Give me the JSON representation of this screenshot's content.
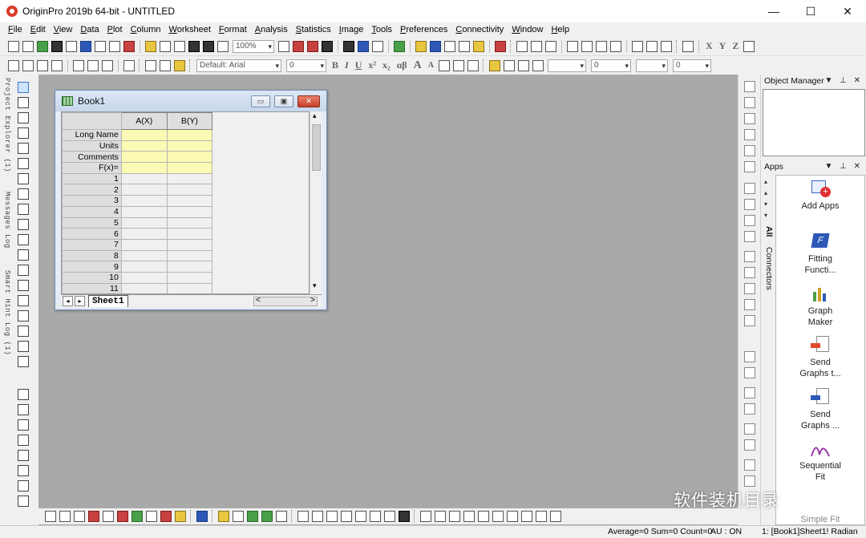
{
  "window": {
    "title": "OriginPro 2019b 64-bit - UNTITLED",
    "min_glyph": "—",
    "max_glyph": "☐",
    "close_glyph": "✕"
  },
  "menu": [
    "File",
    "Edit",
    "View",
    "Data",
    "Plot",
    "Column",
    "Worksheet",
    "Format",
    "Analysis",
    "Statistics",
    "Image",
    "Tools",
    "Preferences",
    "Connectivity",
    "Window",
    "Help"
  ],
  "toolbar": {
    "zoom_value": "100%",
    "font_value": "Default: Arial",
    "font_size_value": "0",
    "bold_label": "B",
    "italic_label": "I",
    "underline_label": "U",
    "superscript_label": "x²",
    "subscript_label": "x₂",
    "greek_label": "αβ",
    "grow_label": "A",
    "shrink_label": "A",
    "line_width_value": "0",
    "line_extra_value": "0",
    "fx_labels": [
      "X",
      "Y",
      "Z"
    ]
  },
  "left_tabs": {
    "project_explorer": "Project Explorer (1)",
    "messages_log": "Messages Log",
    "smart_hint_log": "Smart Hint Log (1)"
  },
  "book": {
    "name": "Book1",
    "min_glyph": "▭",
    "restore_glyph": "▣",
    "close_glyph": "✕",
    "columns": [
      "A(X)",
      "B(Y)"
    ],
    "meta_rows": [
      "Long Name",
      "Units",
      "Comments",
      "F(x)="
    ],
    "rows": [
      "1",
      "2",
      "3",
      "4",
      "5",
      "6",
      "7",
      "8",
      "9",
      "10",
      "11"
    ],
    "sheet_tab": "Sheet1",
    "nav_prev": "◂",
    "nav_next": "▸",
    "scroll_left": "<",
    "scroll_right": ">",
    "scroll_up": "▴",
    "scroll_down": "▾"
  },
  "object_manager": {
    "title": "Object Manager",
    "controls": "▼ ⊥ ✕"
  },
  "apps": {
    "title": "Apps",
    "controls": "▼ ⊥ ✕",
    "tab_all": "All",
    "tab_connectors": "Connectors",
    "items": [
      {
        "line1": "Add Apps",
        "line2": "",
        "icon": "add-apps-icon"
      },
      {
        "line1": "Fitting",
        "line2": "Functi...",
        "icon": "fitting-function-icon"
      },
      {
        "line1": "Graph",
        "line2": "Maker",
        "icon": "graph-maker-icon"
      },
      {
        "line1": "Send",
        "line2": "Graphs t...",
        "icon": "send-graphs-ppt-icon"
      },
      {
        "line1": "Send",
        "line2": "Graphs ...",
        "icon": "send-graphs-word-icon"
      },
      {
        "line1": "Sequential",
        "line2": "Fit",
        "icon": "sequential-fit-icon"
      },
      {
        "line1": "Simple Fit",
        "line2": "",
        "icon": "simple-fit-icon"
      }
    ]
  },
  "status": {
    "stats": "Average=0 Sum=0 Count=0",
    "au": "AU : ON",
    "sheet": "1: [Book1]Sheet1!  Radian"
  },
  "watermark": "软件装机目录",
  "colors": {
    "workspace": "#a9a9a9",
    "meta_row": "#fafab4",
    "accent_blue": "#2e58b8"
  }
}
